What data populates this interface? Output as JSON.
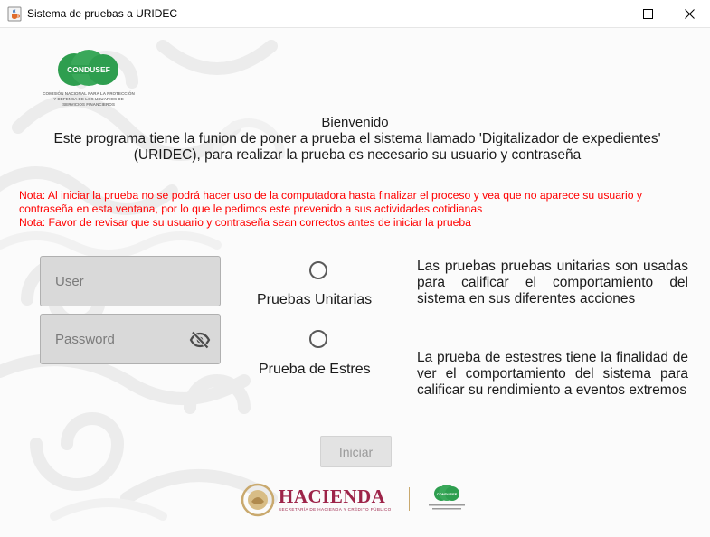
{
  "window": {
    "title": "Sistema de pruebas a URIDEC"
  },
  "logo": {
    "brand": "CONDUSEF",
    "tagline": "COMISIÓN NACIONAL PARA LA PROTECCIÓN Y DEFENSA DE LOS USUARIOS DE SERVICIOS FINANCIEROS"
  },
  "header": {
    "welcome": "Bienvenido",
    "intro": "Este programa tiene la funion de poner a prueba el sistema llamado 'Digitalizador de expedientes' (URIDEC), para realizar la prueba es necesario su usuario y contraseña"
  },
  "notes": {
    "note1": "Nota: Al iniciar la prueba no se podrá hacer uso de la computadora hasta finalizar el proceso y vea que no aparece su usuario y contraseña en esta ventana, por lo que le pedimos este prevenido a sus actividades cotidianas",
    "note2": "Nota: Favor de revisar que su usuario y contraseña sean correctos antes de iniciar la prueba"
  },
  "form": {
    "user_placeholder": "User",
    "password_placeholder": "Password"
  },
  "options": [
    {
      "label": "Pruebas Unitarias",
      "description": "Las pruebas pruebas unitarias son usadas para calificar el comportamiento del sistema en sus diferentes acciones",
      "selected": false
    },
    {
      "label": "Prueba de Estres",
      "description": "La prueba de estestres tiene la finalidad de ver el comportamiento del sistema para calificar su rendimiento a eventos extremos",
      "selected": false
    }
  ],
  "actions": {
    "start_label": "Iniciar",
    "start_enabled": false
  },
  "footer": {
    "hacienda": "HACIENDA",
    "hacienda_sub": "SECRETARÍA DE HACIENDA Y CRÉDITO PÚBLICO",
    "condusef_small": "CONDUSEF"
  },
  "colors": {
    "note_red": "#ff0000",
    "brand_green": "#2e9e4f",
    "hacienda_maroon": "#9d2449"
  },
  "icons": {
    "app": "java-cup-icon",
    "visibility": "visibility-off-icon"
  }
}
